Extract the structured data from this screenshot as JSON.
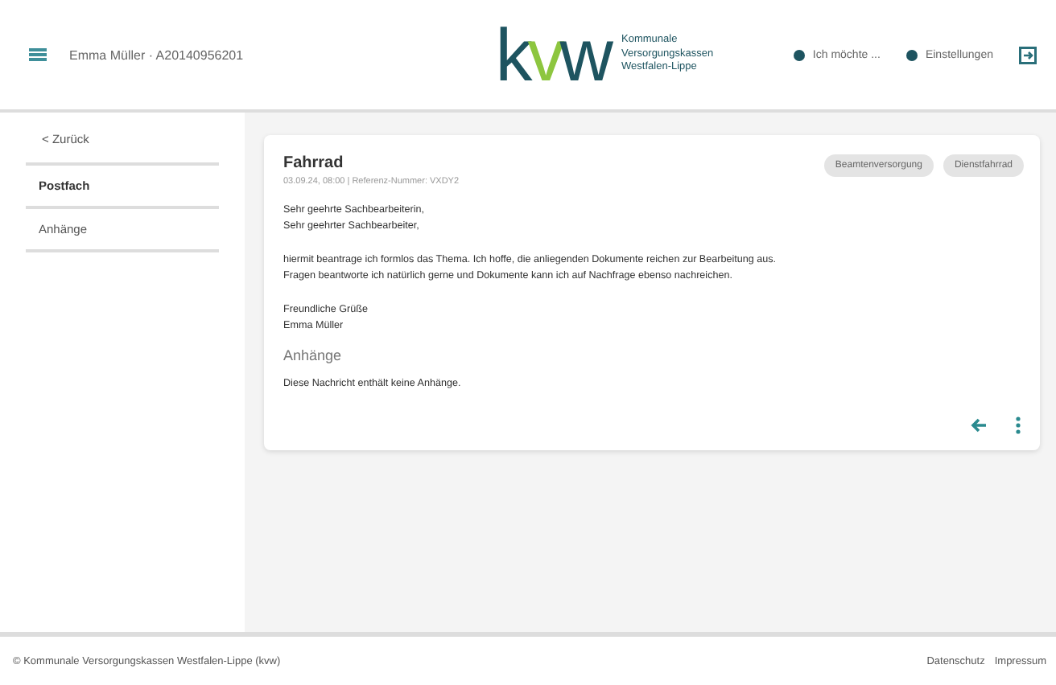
{
  "header": {
    "user": "Emma Müller · A20140956201",
    "logo": "kvw",
    "logo_caption": [
      "Kommunale",
      "Versorgungskassen",
      "Westfalen-Lippe"
    ],
    "actions": [
      {
        "label": "Ich möchte ..."
      },
      {
        "label": "Einstellungen"
      }
    ]
  },
  "sidebar": {
    "back": "< Zurück",
    "items": [
      {
        "label": "Postfach",
        "selected": true
      },
      {
        "label": "Anhänge",
        "selected": false
      }
    ]
  },
  "message": {
    "title": "Fahrrad",
    "meta": "03.09.24, 08:00 | Referenz-Nummer: VXDY2",
    "tags": [
      "Beamtenversorgung",
      "Dienstfahrrad"
    ],
    "paragraphs": [
      [
        "Sehr geehrte Sachbearbeiterin,",
        "Sehr geehrter Sachbearbeiter,"
      ],
      [
        "hiermit beantrage ich formlos das Thema. Ich hoffe, die anliegenden Dokumente reichen zur Bearbeitung aus.",
        "Fragen beantworte ich natürlich gerne und Dokumente kann ich auf Nachfrage ebenso nachreichen."
      ],
      [
        "Freundliche Grüße",
        "Emma Müller"
      ]
    ],
    "attachments_title": "Anhänge",
    "attachments_note": "Diese Nachricht enthält keine Anhänge."
  },
  "footer": {
    "copyright": "© Kommunale Versorgungskassen Westfalen-Lippe (kvw)",
    "links": [
      "Datenschutz",
      "Impressum"
    ]
  }
}
